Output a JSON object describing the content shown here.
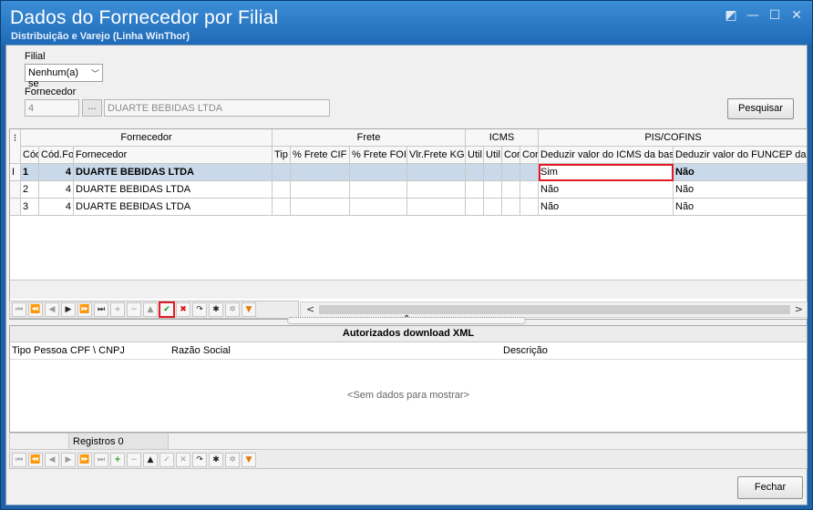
{
  "window": {
    "title": "Dados do Fornecedor por Filial",
    "subtitle": "Distribuição e Varejo (Linha WinThor)",
    "controls": [
      "◩",
      "—",
      "☐",
      "✕"
    ]
  },
  "filters": {
    "filial_label": "Filial",
    "filial_value": "Nenhum(a) se",
    "fornecedor_label": "Fornecedor",
    "fornecedor_code": "4",
    "lookup_label": "...",
    "fornecedor_name": "DUARTE BEBIDAS LTDA",
    "search_label": "Pesquisar"
  },
  "grid": {
    "band_fornecedor": "Fornecedor",
    "band_frete": "Frete",
    "band_icms": "ICMS",
    "band_piscofins": "PIS/COFINS",
    "columns": [
      "Cód",
      "Cód.Fo",
      "Fornecedor",
      "Tip",
      "% Frete CIF",
      "% Frete FOI",
      "Vlr.Frete KG",
      "Util",
      "Util",
      "Cor",
      "Cor",
      "Deduzir valor do ICMS da bas",
      "Deduzir valor do FUNCEP da b"
    ],
    "rows": [
      {
        "indicator": "I",
        "cod": "1",
        "codfor": "4",
        "fornecedor": "DUARTE BEBIDAS LTDA",
        "icms": "Sim",
        "funcep": "Não"
      },
      {
        "indicator": "",
        "cod": "2",
        "codfor": "4",
        "fornecedor": "DUARTE BEBIDAS LTDA",
        "icms": "Não",
        "funcep": "Não"
      },
      {
        "indicator": "",
        "cod": "3",
        "codfor": "4",
        "fornecedor": "DUARTE BEBIDAS LTDA",
        "icms": "Não",
        "funcep": "Não"
      }
    ]
  },
  "navigator_icons": [
    "first-icon",
    "prev-page-icon",
    "prev-icon",
    "next-icon",
    "next-page-icon",
    "last-icon",
    "insert-icon",
    "delete-icon",
    "edit-icon",
    "post-icon",
    "cancel-icon",
    "refresh-icon",
    "asterisk-icon",
    "asterisk-outline-icon",
    "filter-icon"
  ],
  "scroll": {
    "left": "<",
    "right": ">"
  },
  "xml_panel": {
    "title": "Autorizados download XML",
    "columns": [
      "Tipo Pessoa",
      "CPF \\ CNPJ",
      "Razão Social",
      "Descrição"
    ],
    "empty_text": "<Sem dados para mostrar>",
    "records": "Registros 0"
  },
  "footer": {
    "close_label": "Fechar"
  },
  "colors": {
    "title_blue": "#1f6ab8",
    "selection": "#c9d9ea",
    "highlight": "#e01b24"
  }
}
